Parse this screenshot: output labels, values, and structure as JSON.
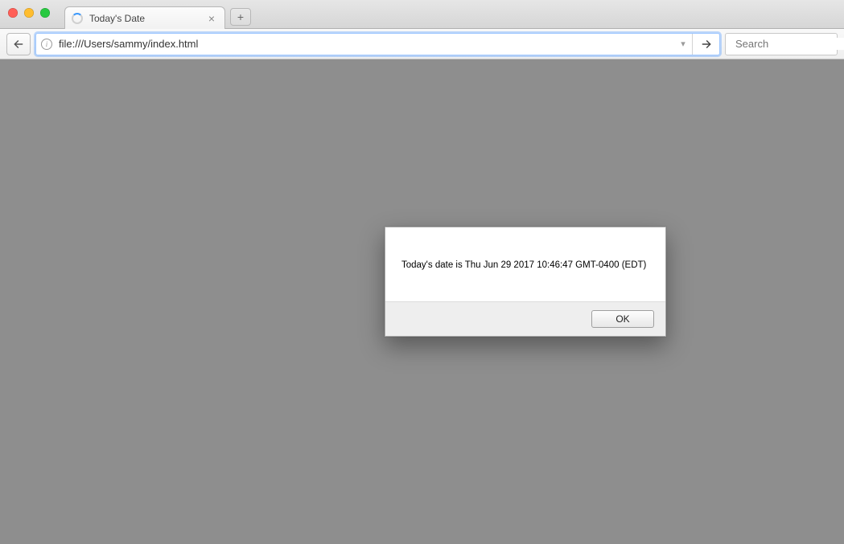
{
  "window": {
    "tab": {
      "title": "Today's Date",
      "close_glyph": "×"
    },
    "new_tab_glyph": "+"
  },
  "toolbar": {
    "address_value": "file:///Users/sammy/index.html",
    "info_glyph": "i",
    "dropdown_glyph": "▾",
    "search_placeholder": "Search"
  },
  "dialog": {
    "message": "Today's date is Thu Jun 29 2017 10:46:47 GMT-0400 (EDT)",
    "ok_label": "OK"
  }
}
